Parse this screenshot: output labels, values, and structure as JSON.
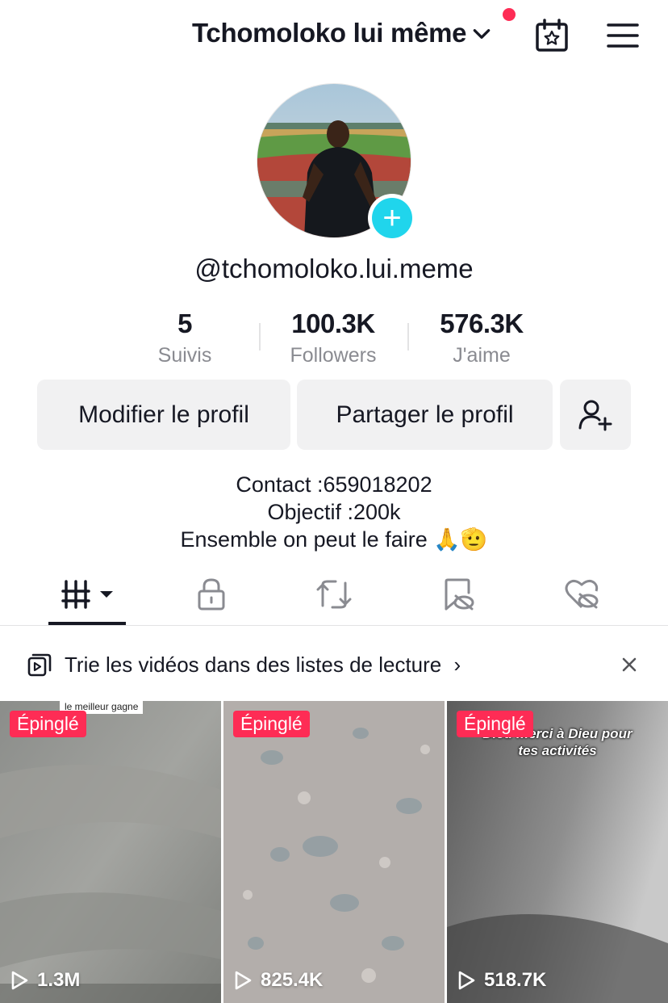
{
  "header": {
    "title": "Tchomoloko lui même",
    "icons": [
      "chevron-down-icon",
      "calendar-star-icon",
      "menu-icon"
    ],
    "notification_color": "#fe2c55"
  },
  "profile": {
    "handle": "@tchomoloko.lui.meme",
    "add_badge_color": "#20d5ec"
  },
  "stats": [
    {
      "value": "5",
      "label": "Suivis"
    },
    {
      "value": "100.3K",
      "label": "Followers"
    },
    {
      "value": "576.3K",
      "label": "J'aime"
    }
  ],
  "buttons": {
    "edit": "Modifier le profil",
    "share": "Partager le profil",
    "add_friend_icon": "add-user-icon"
  },
  "bio": {
    "line1": "Contact :659018202",
    "line2": "Objectif :200k",
    "line3": "Ensemble on peut le faire 🙏🫡"
  },
  "tabs": [
    "videos-grid-icon",
    "lock-icon",
    "repost-icon",
    "saved-hidden-icon",
    "liked-hidden-icon"
  ],
  "banner": {
    "text": "Trie les vidéos dans des listes de lecture",
    "chevron": "›"
  },
  "videos": [
    {
      "pinned_label": "Épinglé",
      "views": "1.3M",
      "sticker": "le meilleur gagne"
    },
    {
      "pinned_label": "Épinglé",
      "views": "825.4K"
    },
    {
      "pinned_label": "Épinglé",
      "views": "518.7K",
      "caption": "Dieu merci à Dieu pour tes activités"
    }
  ],
  "colors": {
    "accent": "#fe2c55",
    "text": "#161823",
    "muted": "#8a8b91",
    "button_bg": "#f1f1f2"
  }
}
